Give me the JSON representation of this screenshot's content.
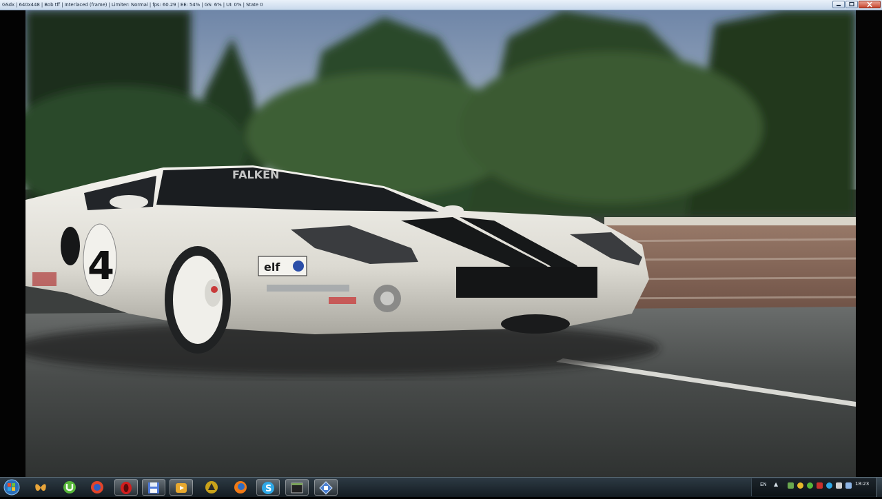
{
  "window": {
    "title": "GSdx | 640x448 | Bob tff | Interlaced (frame) | Limiter: Normal | fps: 60.29 | EE: 54% | GS: 6% | UI: 0% | State 0",
    "buttons": [
      "minimize",
      "maximize",
      "close"
    ]
  },
  "game": {
    "scene": "race-car-on-track",
    "car_number": "4",
    "sponsor_label": "elf"
  },
  "taskbar": {
    "start_icon": "windows-orb-icon",
    "pinned": [
      {
        "name": "butterfly-icon",
        "color": "#e9a53a"
      },
      {
        "name": "utorrent-icon",
        "color": "#58b83a"
      },
      {
        "name": "media-player-icon",
        "color": "#e2442a"
      },
      {
        "name": "opera-icon",
        "color": "#d21e1e"
      },
      {
        "name": "floppy-save-icon",
        "color": "#4f7ad8"
      },
      {
        "name": "video-player-icon",
        "color": "#e8a82e"
      },
      {
        "name": "daemon-tools-icon",
        "color": "#c9a21a"
      },
      {
        "name": "firefox-icon",
        "color": "#f07a16"
      },
      {
        "name": "skype-icon",
        "color": "#2fa8e6"
      },
      {
        "name": "terminal-window-icon",
        "color": "#7aa25a"
      },
      {
        "name": "pcsx2-icon",
        "color": "#4b7fd0"
      }
    ],
    "tray": {
      "language": "EN",
      "clock": "18:23"
    }
  }
}
